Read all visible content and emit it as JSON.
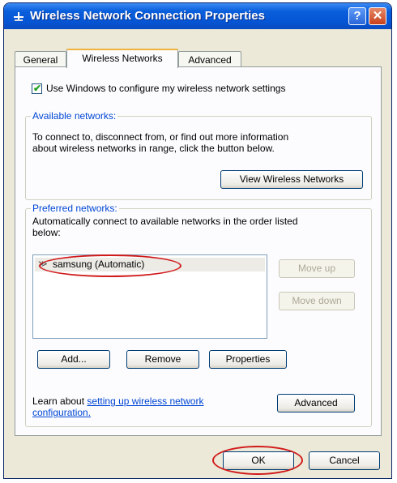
{
  "window": {
    "title": "Wireless Network Connection Properties"
  },
  "titlebar": {
    "help_label": "?",
    "close_label": "✕"
  },
  "tabs": [
    {
      "label": "General"
    },
    {
      "label": "Wireless Networks"
    },
    {
      "label": "Advanced"
    }
  ],
  "use_windows_checkbox": {
    "label": "Use Windows to configure my wireless network settings",
    "checked": true
  },
  "available_networks": {
    "title": "Available networks:",
    "description_line1": "To connect to, disconnect from, or find out more information",
    "description_line2": "about wireless networks in range, click the button below.",
    "view_button": "View Wireless Networks"
  },
  "preferred_networks": {
    "title": "Preferred networks:",
    "description_line1": "Automatically connect to available networks in the order listed",
    "description_line2": "below:",
    "items": [
      {
        "label": "samsung (Automatic)",
        "icon": "wireless-network-icon"
      }
    ],
    "move_up": "Move up",
    "move_down": "Move down",
    "add": "Add...",
    "remove": "Remove",
    "properties": "Properties",
    "learn_prefix": "Learn about",
    "learn_link_line1": "setting up wireless network",
    "learn_link_line2": "configuration.",
    "advanced": "Advanced"
  },
  "footer": {
    "ok": "OK",
    "cancel": "Cancel"
  },
  "colors": {
    "annotation": "#d11a1a",
    "title_bar": "#0a5fdc"
  }
}
